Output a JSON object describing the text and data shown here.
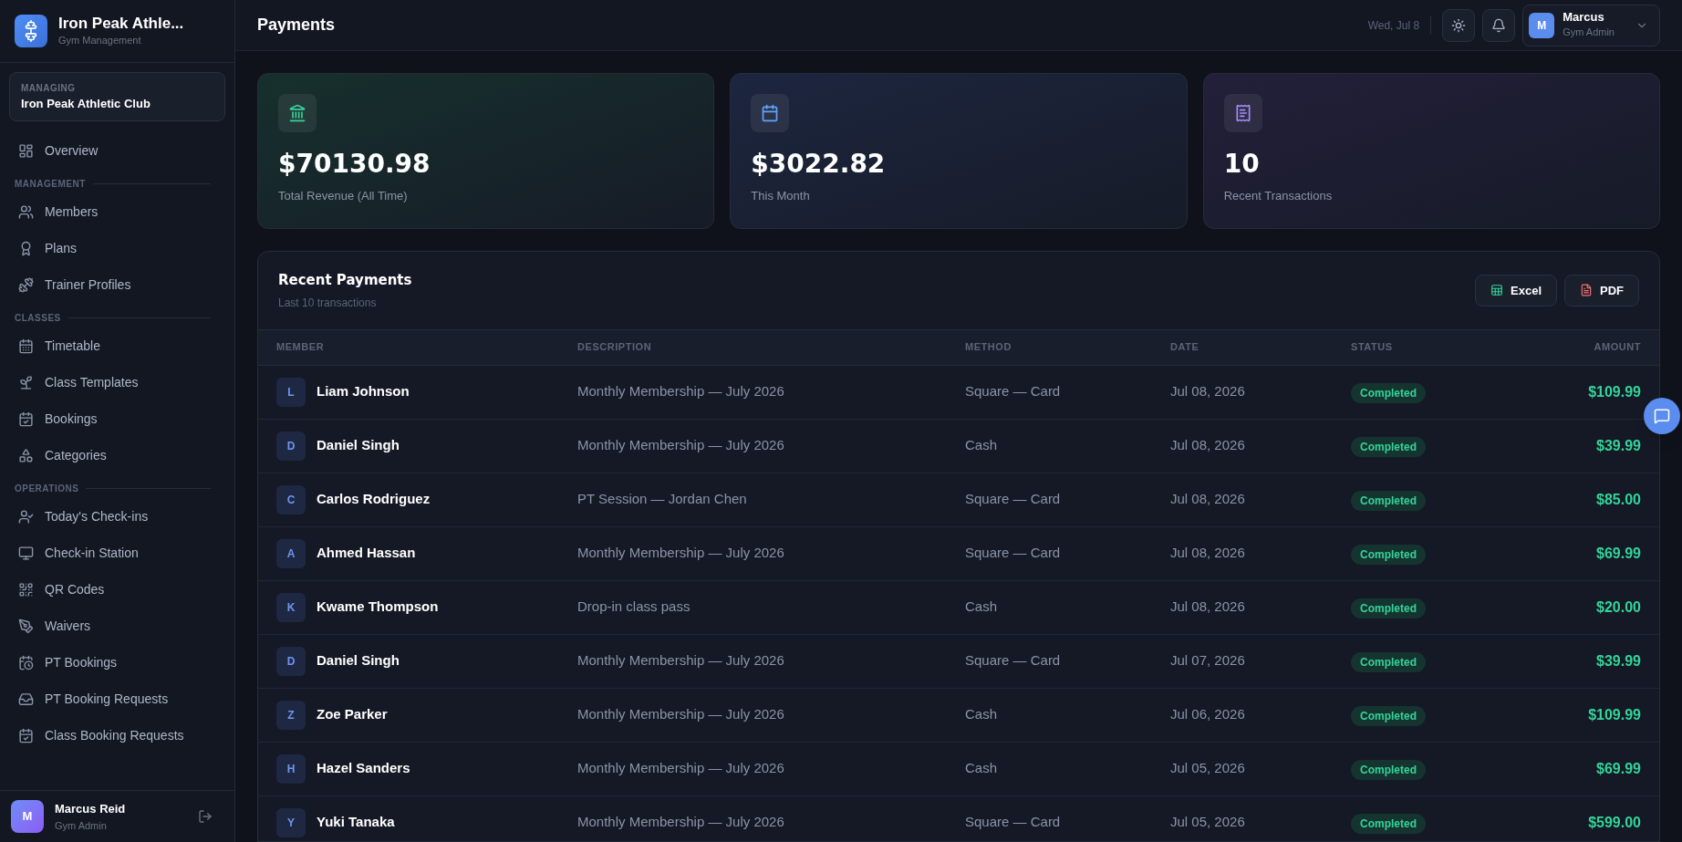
{
  "brand": {
    "name": "Iron Peak Athle...",
    "subtitle": "Gym Management"
  },
  "managing": {
    "label": "MANAGING",
    "value": "Iron Peak Athletic Club"
  },
  "nav": [
    {
      "kind": "item",
      "label": "Overview"
    },
    {
      "kind": "section",
      "label": "MANAGEMENT"
    },
    {
      "kind": "item",
      "label": "Members"
    },
    {
      "kind": "item",
      "label": "Plans"
    },
    {
      "kind": "item",
      "label": "Trainer Profiles"
    },
    {
      "kind": "section",
      "label": "CLASSES"
    },
    {
      "kind": "item",
      "label": "Timetable"
    },
    {
      "kind": "item",
      "label": "Class Templates"
    },
    {
      "kind": "item",
      "label": "Bookings"
    },
    {
      "kind": "item",
      "label": "Categories"
    },
    {
      "kind": "section",
      "label": "OPERATIONS"
    },
    {
      "kind": "item",
      "label": "Today's Check-ins"
    },
    {
      "kind": "item",
      "label": "Check-in Station"
    },
    {
      "kind": "item",
      "label": "QR Codes"
    },
    {
      "kind": "item",
      "label": "Waivers"
    },
    {
      "kind": "item",
      "label": "PT Bookings"
    },
    {
      "kind": "item",
      "label": "PT Booking Requests"
    },
    {
      "kind": "item",
      "label": "Class Booking Requests"
    }
  ],
  "sidebar_user": {
    "initial": "M",
    "name": "Marcus Reid",
    "role": "Gym Admin"
  },
  "header": {
    "title": "Payments",
    "date": "Wed, Jul 8",
    "user": {
      "initial": "M",
      "name": "Marcus",
      "role": "Gym Admin"
    }
  },
  "stats": [
    {
      "color": "#34d399",
      "value": "$70130.98",
      "label": "Total Revenue (All Time)"
    },
    {
      "color": "#60a5fa",
      "value": "$3022.82",
      "label": "This Month"
    },
    {
      "color": "#a78bfa",
      "value": "10",
      "label": "Recent Transactions"
    }
  ],
  "payments": {
    "title": "Recent Payments",
    "subtitle": "Last 10 transactions",
    "buttons": [
      {
        "kind": "excel",
        "label": "Excel"
      },
      {
        "kind": "pdf",
        "label": "PDF"
      }
    ],
    "columns": [
      "MEMBER",
      "DESCRIPTION",
      "METHOD",
      "DATE",
      "STATUS",
      "AMOUNT"
    ],
    "rows": [
      {
        "initial": "L",
        "member": "Liam Johnson",
        "description": "Monthly Membership — July 2026",
        "method": "Square — Card",
        "date": "Jul 08, 2026",
        "status": "Completed",
        "amount": "$109.99"
      },
      {
        "initial": "D",
        "member": "Daniel Singh",
        "description": "Monthly Membership — July 2026",
        "method": "Cash",
        "date": "Jul 08, 2026",
        "status": "Completed",
        "amount": "$39.99"
      },
      {
        "initial": "C",
        "member": "Carlos Rodriguez",
        "description": "PT Session — Jordan Chen",
        "method": "Square — Card",
        "date": "Jul 08, 2026",
        "status": "Completed",
        "amount": "$85.00"
      },
      {
        "initial": "A",
        "member": "Ahmed Hassan",
        "description": "Monthly Membership — July 2026",
        "method": "Square — Card",
        "date": "Jul 08, 2026",
        "status": "Completed",
        "amount": "$69.99"
      },
      {
        "initial": "K",
        "member": "Kwame Thompson",
        "description": "Drop-in class pass",
        "method": "Cash",
        "date": "Jul 08, 2026",
        "status": "Completed",
        "amount": "$20.00"
      },
      {
        "initial": "D",
        "member": "Daniel Singh",
        "description": "Monthly Membership — July 2026",
        "method": "Square — Card",
        "date": "Jul 07, 2026",
        "status": "Completed",
        "amount": "$39.99"
      },
      {
        "initial": "Z",
        "member": "Zoe Parker",
        "description": "Monthly Membership — July 2026",
        "method": "Cash",
        "date": "Jul 06, 2026",
        "status": "Completed",
        "amount": "$109.99"
      },
      {
        "initial": "H",
        "member": "Hazel Sanders",
        "description": "Monthly Membership — July 2026",
        "method": "Cash",
        "date": "Jul 05, 2026",
        "status": "Completed",
        "amount": "$69.99"
      },
      {
        "initial": "Y",
        "member": "Yuki Tanaka",
        "description": "Monthly Membership — July 2026",
        "method": "Square — Card",
        "date": "Jul 05, 2026",
        "status": "Completed",
        "amount": "$599.00"
      }
    ]
  }
}
